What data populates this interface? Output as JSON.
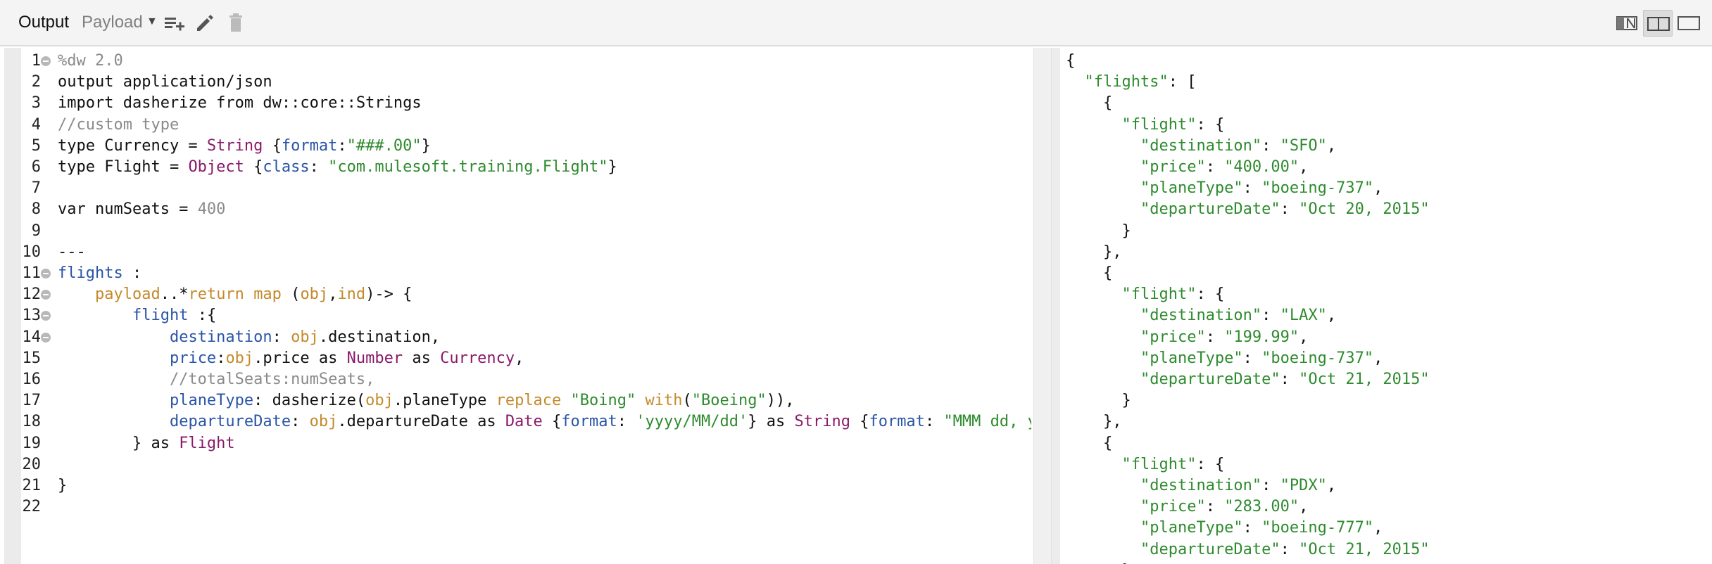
{
  "toolbar": {
    "title": "Output",
    "payload_label": "Payload",
    "icons": [
      "add-list-icon",
      "pencil-icon",
      "trash-icon"
    ],
    "view_buttons": [
      "single-pane-view-icon",
      "split-view-icon",
      "wide-view-icon"
    ],
    "active_view": "split-view-icon"
  },
  "editor": {
    "lines": [
      {
        "n": "1",
        "fold": true,
        "text": "%dw 2.0"
      },
      {
        "n": "2",
        "fold": false,
        "text": "output application/json"
      },
      {
        "n": "3",
        "fold": false,
        "text": "import dasherize from dw::core::Strings"
      },
      {
        "n": "4",
        "fold": false,
        "text": "//custom type"
      },
      {
        "n": "5",
        "fold": false,
        "text": "type Currency = String {format:\"###.00\"}"
      },
      {
        "n": "6",
        "fold": false,
        "text": "type Flight = Object {class: \"com.mulesoft.training.Flight\"}"
      },
      {
        "n": "7",
        "fold": false,
        "text": ""
      },
      {
        "n": "8",
        "fold": false,
        "text": "var numSeats = 400"
      },
      {
        "n": "9",
        "fold": false,
        "text": ""
      },
      {
        "n": "10",
        "fold": false,
        "text": "---"
      },
      {
        "n": "11",
        "fold": true,
        "text": "flights :"
      },
      {
        "n": "12",
        "fold": true,
        "text": "    payload..*return map (obj,ind)-> {"
      },
      {
        "n": "13",
        "fold": true,
        "text": "        flight :{"
      },
      {
        "n": "14",
        "fold": true,
        "text": "            destination: obj.destination,"
      },
      {
        "n": "15",
        "fold": false,
        "text": "            price:obj.price as Number as Currency,"
      },
      {
        "n": "16",
        "fold": false,
        "text": "            //totalSeats:numSeats,"
      },
      {
        "n": "17",
        "fold": false,
        "text": "            planeType: dasherize(obj.planeType replace \"Boing\" with(\"Boeing\")),"
      },
      {
        "n": "18",
        "fold": false,
        "text": "            departureDate: obj.departureDate as Date {format: 'yyyy/MM/dd'} as String {format: \"MMM dd, y"
      },
      {
        "n": "19",
        "fold": false,
        "text": "        } as Flight"
      },
      {
        "n": "20",
        "fold": false,
        "text": ""
      },
      {
        "n": "21",
        "fold": false,
        "text": "}"
      },
      {
        "n": "22",
        "fold": false,
        "text": ""
      }
    ]
  },
  "output": {
    "lines": [
      "{",
      "  \"flights\": [",
      "    {",
      "      \"flight\": {",
      "        \"destination\": \"SFO\",",
      "        \"price\": \"400.00\",",
      "        \"planeType\": \"boeing-737\",",
      "        \"departureDate\": \"Oct 20, 2015\"",
      "      }",
      "    },",
      "    {",
      "      \"flight\": {",
      "        \"destination\": \"LAX\",",
      "        \"price\": \"199.99\",",
      "        \"planeType\": \"boeing-737\",",
      "        \"departureDate\": \"Oct 21, 2015\"",
      "      }",
      "    },",
      "    {",
      "      \"flight\": {",
      "        \"destination\": \"PDX\",",
      "        \"price\": \"283.00\",",
      "        \"planeType\": \"boeing-777\",",
      "        \"departureDate\": \"Oct 21, 2015\"",
      "      }"
    ]
  },
  "colors": {
    "keyword": "#c48a2a",
    "field": "#2a54a6",
    "string": "#2e8b2e",
    "type": "#8a1a6a",
    "comment": "#8a8a8a"
  }
}
